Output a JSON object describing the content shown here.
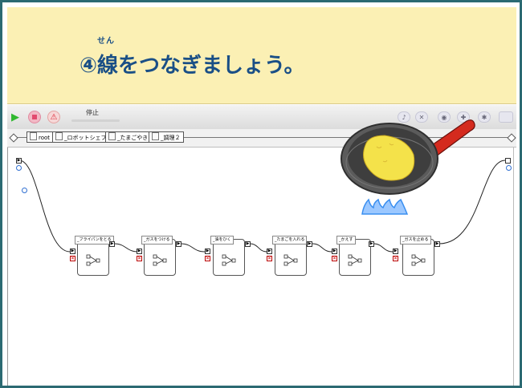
{
  "banner": {
    "furigana": "せん",
    "title": "④線をつなぎましょう。"
  },
  "toolbar": {
    "status_label": "停止"
  },
  "breadcrumbs": [
    {
      "label": "root"
    },
    {
      "label": "_ロボットシェフ"
    },
    {
      "label": "_たまごやき"
    },
    {
      "label": "_調理２"
    }
  ],
  "nodes": [
    {
      "label": "_フライパンをとる"
    },
    {
      "label": "_ガスをつける"
    },
    {
      "label": "_油をひく"
    },
    {
      "label": "_たまごを入れる"
    },
    {
      "label": "_かえす"
    },
    {
      "label": "_ガスを止める"
    }
  ],
  "colors": {
    "banner_bg": "#fbf0b4",
    "title_text": "#1a4f86",
    "frame": "#2b6a72",
    "pan_handle": "#d42a1e",
    "egg": "#f4e24a",
    "flame": "#3a8ff0"
  },
  "icons": [
    "play-icon",
    "stop-icon",
    "warning-icon",
    "frying-pan-icon",
    "gas-flame-icon"
  ]
}
